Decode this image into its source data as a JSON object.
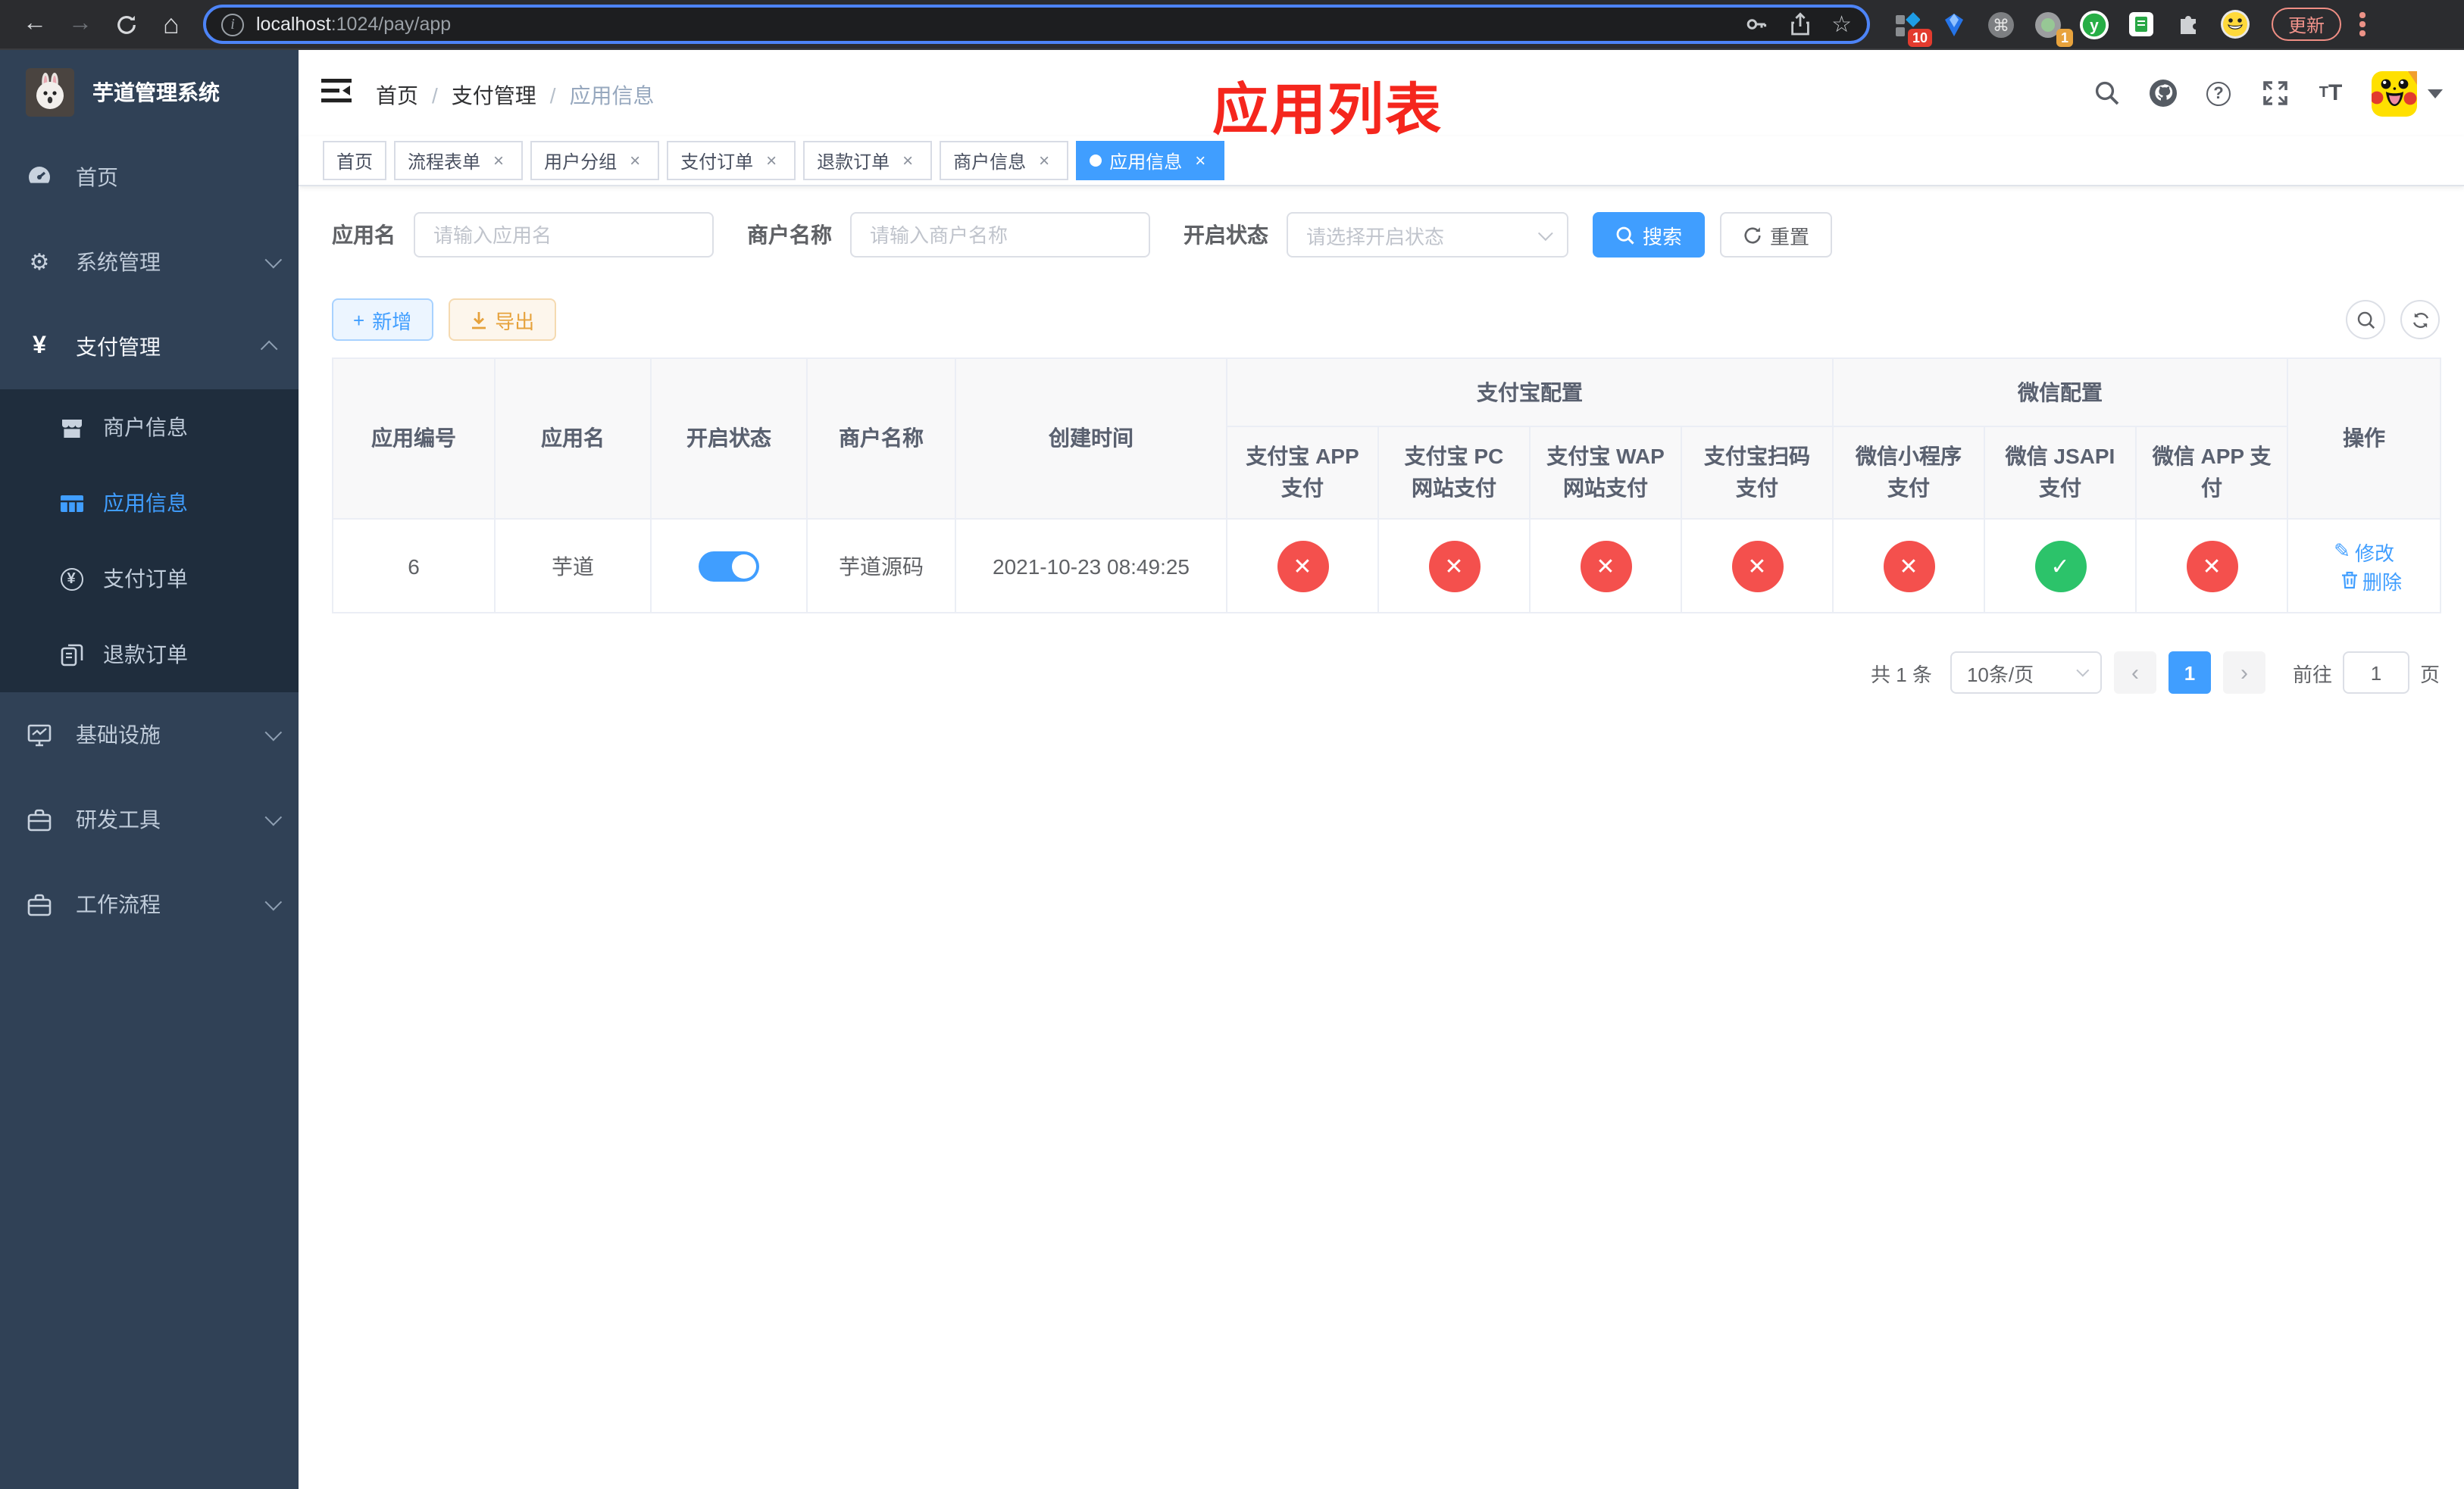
{
  "browser": {
    "url": {
      "host": "localhost",
      "path": ":1024/pay/app"
    },
    "update_button": "更新",
    "ext_badge_grid": "10",
    "ext_badge_profile": "1",
    "ext_y_label": "y",
    "info_glyph": "i"
  },
  "icons": {
    "back": "←",
    "forward": "→",
    "home": "⌂",
    "star": "☆",
    "command": "⌘",
    "close": "×",
    "gear": "⚙",
    "yen": "¥",
    "check": "✓",
    "cross": "✕",
    "plus": "+",
    "chevron_left": "‹",
    "chevron_right": "›",
    "edit": "✎",
    "help": "?",
    "font_big": "T",
    "font_small": "T"
  },
  "sidebar": {
    "title": "芋道管理系统",
    "menu": [
      {
        "label": "首页"
      },
      {
        "label": "系统管理"
      },
      {
        "label": "支付管理"
      }
    ],
    "submenu": [
      {
        "label": "商户信息"
      },
      {
        "label": "应用信息"
      },
      {
        "label": "支付订单"
      },
      {
        "label": "退款订单"
      }
    ],
    "menu_bottom": [
      {
        "label": "基础设施"
      },
      {
        "label": "研发工具"
      },
      {
        "label": "工作流程"
      }
    ]
  },
  "header": {
    "breadcrumb": [
      "首页",
      "支付管理",
      "应用信息"
    ],
    "separator": "/",
    "overlay_title": "应用列表"
  },
  "tabs": [
    {
      "label": "首页"
    },
    {
      "label": "流程表单"
    },
    {
      "label": "用户分组"
    },
    {
      "label": "支付订单"
    },
    {
      "label": "退款订单"
    },
    {
      "label": "商户信息"
    },
    {
      "label": "应用信息"
    }
  ],
  "filters": {
    "app_name": {
      "label": "应用名",
      "placeholder": "请输入应用名"
    },
    "merchant_name": {
      "label": "商户名称",
      "placeholder": "请输入商户名称"
    },
    "status": {
      "label": "开启状态",
      "placeholder": "请选择开启状态"
    },
    "search": "搜索",
    "reset": "重置"
  },
  "toolbar": {
    "add": "新增",
    "export": "导出"
  },
  "table": {
    "columns": {
      "app_id": "应用编号",
      "app_name": "应用名",
      "status": "开启状态",
      "merchant": "商户名称",
      "created": "创建时间",
      "alipay_group": "支付宝配置",
      "wechat_group": "微信配置",
      "alipay_app": "支付宝 APP 支付",
      "alipay_pc": "支付宝 PC 网站支付",
      "alipay_wap": "支付宝 WAP 网站支付",
      "alipay_qr": "支付宝扫码支付",
      "wx_lite": "微信小程序支付",
      "wx_jsapi": "微信 JSAPI 支付",
      "wx_app": "微信 APP 支付",
      "actions": "操作"
    },
    "rows": [
      {
        "app_id": "6",
        "app_name": "芋道",
        "status_on": true,
        "merchant": "芋道源码",
        "created": "2021-10-23 08:49:25",
        "alipay_app": "no",
        "alipay_pc": "no",
        "alipay_wap": "no",
        "alipay_qr": "no",
        "wx_lite": "no",
        "wx_jsapi": "yes",
        "wx_app": "no",
        "edit": "修改",
        "delete": "删除"
      }
    ]
  },
  "pagination": {
    "total": "共 1 条",
    "page_size": "10条/页",
    "page": "1",
    "goto_label": "前往",
    "goto_value": "1",
    "goto_unit": "页"
  },
  "colors": {
    "accent": "#409eff",
    "danger": "#f4504d",
    "success": "#2cc36a",
    "overlay_title": "#f5261d",
    "sidebar_bg": "#304156",
    "submenu_bg": "#1f2d3d"
  }
}
